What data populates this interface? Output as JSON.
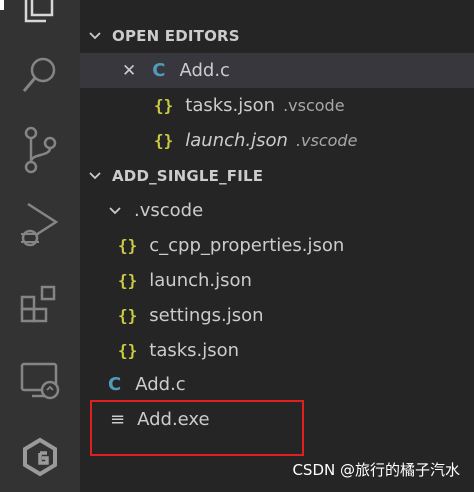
{
  "activity_bar": {
    "icons": [
      "files-icon",
      "search-icon",
      "source-control-icon",
      "run-debug-icon",
      "extensions-icon",
      "remote-explorer-icon",
      "gitlens-icon"
    ]
  },
  "open_editors": {
    "header": "OPEN EDITORS",
    "items": [
      {
        "icon_text": "C",
        "name": "Add.c",
        "description": "",
        "close_symbol": "✕"
      },
      {
        "icon_text": "{}",
        "name": "tasks.json",
        "description": ".vscode"
      },
      {
        "icon_text": "{}",
        "name": "launch.json",
        "description": ".vscode"
      }
    ]
  },
  "workspace": {
    "header": "ADD_SINGLE_FILE",
    "folder": ".vscode",
    "folder_files": [
      "c_cpp_properties.json",
      "launch.json",
      "settings.json",
      "tasks.json"
    ],
    "files": [
      {
        "icon_text": "C",
        "name": "Add.c"
      },
      {
        "icon_text": "≡",
        "name": "Add.exe"
      }
    ]
  },
  "watermark": "CSDN @旅行的橘子汽水",
  "colors": {
    "activity_bar": "#333333",
    "sidebar": "#252526",
    "selected_row": "#37373d",
    "json_icon": "#cbcb41",
    "c_icon": "#519aba",
    "highlight_box": "#e02020"
  }
}
